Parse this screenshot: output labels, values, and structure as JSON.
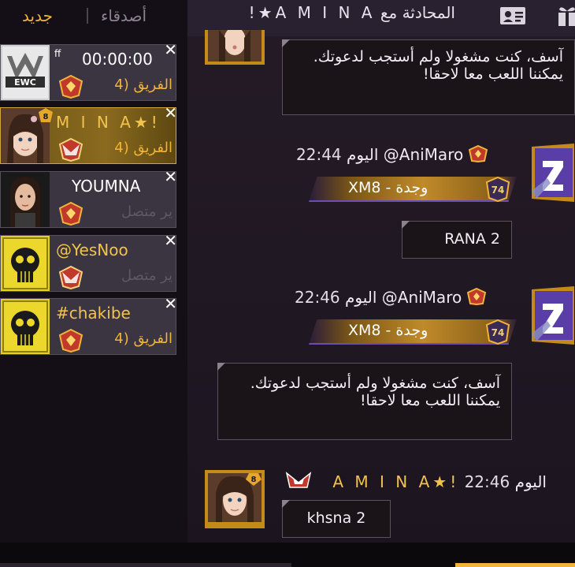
{
  "sidebar": {
    "tabs": {
      "new": "جديد",
      "friends": "أصدقاء"
    },
    "friends": [
      {
        "name": "ff",
        "timer": "00:00:00",
        "status": "الفريق (4",
        "avatar": "ewc-logo"
      },
      {
        "name": "M I N A★!",
        "status": "الفريق (4",
        "avatar": "girl-avatar",
        "vip": "8"
      },
      {
        "name": "YOUMNA",
        "status": "ير متصل",
        "avatar": "woman-avatar"
      },
      {
        "name": "@YesNoo",
        "status": "ير متصل",
        "avatar": "skull-avatar"
      },
      {
        "name": "#chakibe",
        "status": "الفريق (4",
        "avatar": "skull-avatar"
      }
    ]
  },
  "chat": {
    "header": {
      "prefix": "المحادثة مع",
      "name": "A M I N A★!"
    },
    "messages": [
      {
        "text": "آسف، كنت مشغولا ولم أستجب لدعوتك. يمكننا اللعب معا لاحقا!"
      },
      {
        "sender": "@AniMaro",
        "day": "اليوم",
        "time": "22:44",
        "guild": "وجدة - XM8",
        "level": "74",
        "text": "RANA 2"
      },
      {
        "sender": "@AniMaro",
        "day": "اليوم",
        "time": "22:46",
        "guild": "وجدة - XM8",
        "level": "74",
        "text": "آسف، كنت مشغولا ولم أستجب لدعوتك. يمكننا اللعب معا لاحقا!"
      },
      {
        "sender": "A M I N A★!",
        "day": "اليوم",
        "time": "22:46",
        "text": "khsna 2",
        "vip": "8"
      }
    ]
  },
  "colors": {
    "accent": "#f0b43a",
    "panel": "#140f16",
    "chat_bg": "#1f1722",
    "bubble": "#1a1419"
  },
  "icons": [
    "gift-icon",
    "contact-card-icon",
    "close-icon",
    "rank-badge-icon",
    "guild-level-icon"
  ]
}
